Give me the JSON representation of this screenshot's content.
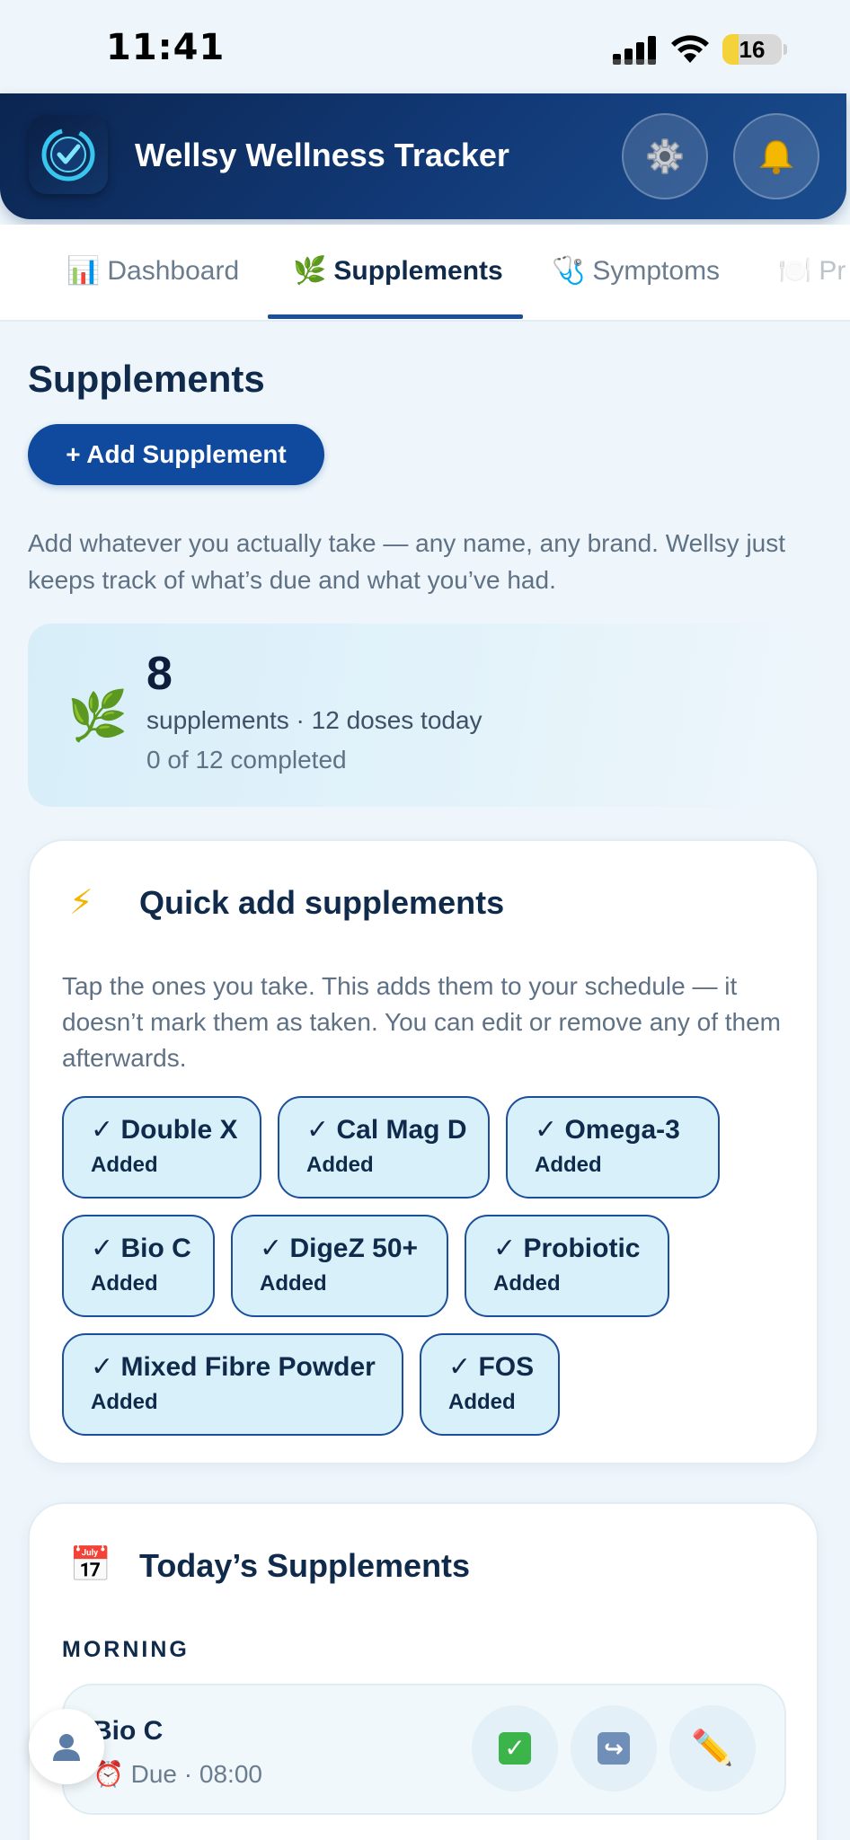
{
  "status_bar": {
    "time": "11:41",
    "battery_level": "16",
    "battery_fraction": 0.16
  },
  "header": {
    "title": "Wellsy Wellness Tracker",
    "logo_icon": "heart-check-icon",
    "settings_icon": "gear-icon",
    "notifications_icon": "bell-icon"
  },
  "tabs": [
    {
      "icon": "📊",
      "label": "Dashboard",
      "active": false
    },
    {
      "icon": "🌿",
      "label": "Supplements",
      "active": true
    },
    {
      "icon": "🩺",
      "label": "Symptoms",
      "active": false
    },
    {
      "icon": "🍽️",
      "label": "Pr",
      "active": false
    }
  ],
  "page": {
    "title": "Supplements",
    "add_button_label": "+ Add Supplement",
    "intro": "Add whatever you actually take — any name, any brand. Wellsy just keeps track of what’s due and what you’ve had."
  },
  "summary": {
    "icon": "🌿",
    "count": "8",
    "line1": "supplements · 12 doses today",
    "line2": "0 of 12 completed"
  },
  "quick_add": {
    "icon": "⚡",
    "title": "Quick add supplements",
    "description": "Tap the ones you take. This adds them to your schedule — it doesn’t mark them as taken. You can edit or remove any of them afterwards.",
    "chips": [
      {
        "name": "✓ Double X",
        "state": "Added"
      },
      {
        "name": "✓ Cal Mag D",
        "state": "Added"
      },
      {
        "name": "✓ Omega-3",
        "state": "Added"
      },
      {
        "name": "✓ Bio C",
        "state": "Added"
      },
      {
        "name": "✓ DigeZ 50+",
        "state": "Added"
      },
      {
        "name": "✓ Probiotic",
        "state": "Added"
      },
      {
        "name": "✓ Mixed Fibre Powder",
        "state": "Added"
      },
      {
        "name": "✓ FOS",
        "state": "Added"
      }
    ]
  },
  "today": {
    "icon": "📅",
    "title": "Today’s Supplements",
    "sections": [
      {
        "label": "MORNING",
        "items": [
          {
            "name": "Bio C",
            "due": "⏰ Due · 08:00"
          }
        ]
      }
    ]
  },
  "colors": {
    "brand_navy": "#0f4a9e",
    "header_gradient_start": "#0b2550",
    "chip_fill": "#d8f0fa",
    "chip_border": "#1b4f9c",
    "background": "#eef6fb"
  }
}
